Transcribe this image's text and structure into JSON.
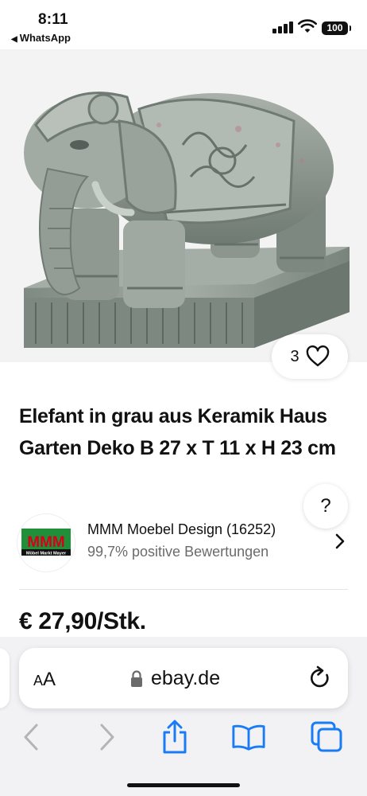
{
  "status_bar": {
    "time": "8:11",
    "back_app": "WhatsApp",
    "battery": "100"
  },
  "product": {
    "like_count": "3",
    "title": "Elefant in grau aus Keramik Haus Garten Deko B 27 x T 11 x H 23 cm",
    "price": "€ 27,90/Stk."
  },
  "help": {
    "label": "?"
  },
  "seller": {
    "logo_text": "MMM",
    "logo_subtext": "Möbel Markt Mayer",
    "name": "MMM Moebel Design (16252)",
    "rating": "99,7% positive Bewertungen"
  },
  "browser": {
    "aa_label_small": "A",
    "aa_label_large": "A",
    "url": "ebay.de"
  },
  "icons": {
    "like": "heart-icon",
    "seller_arrow": "chevron-right-icon",
    "lock": "lock-icon",
    "reload": "reload-icon",
    "back": "chevron-left-icon",
    "forward": "chevron-right-icon",
    "share": "share-icon",
    "bookmarks": "book-icon",
    "tabs": "tabs-icon"
  },
  "colors": {
    "accent_blue": "#1a7cf5",
    "logo_green": "#1f8f3a",
    "logo_red": "#d6001c"
  }
}
